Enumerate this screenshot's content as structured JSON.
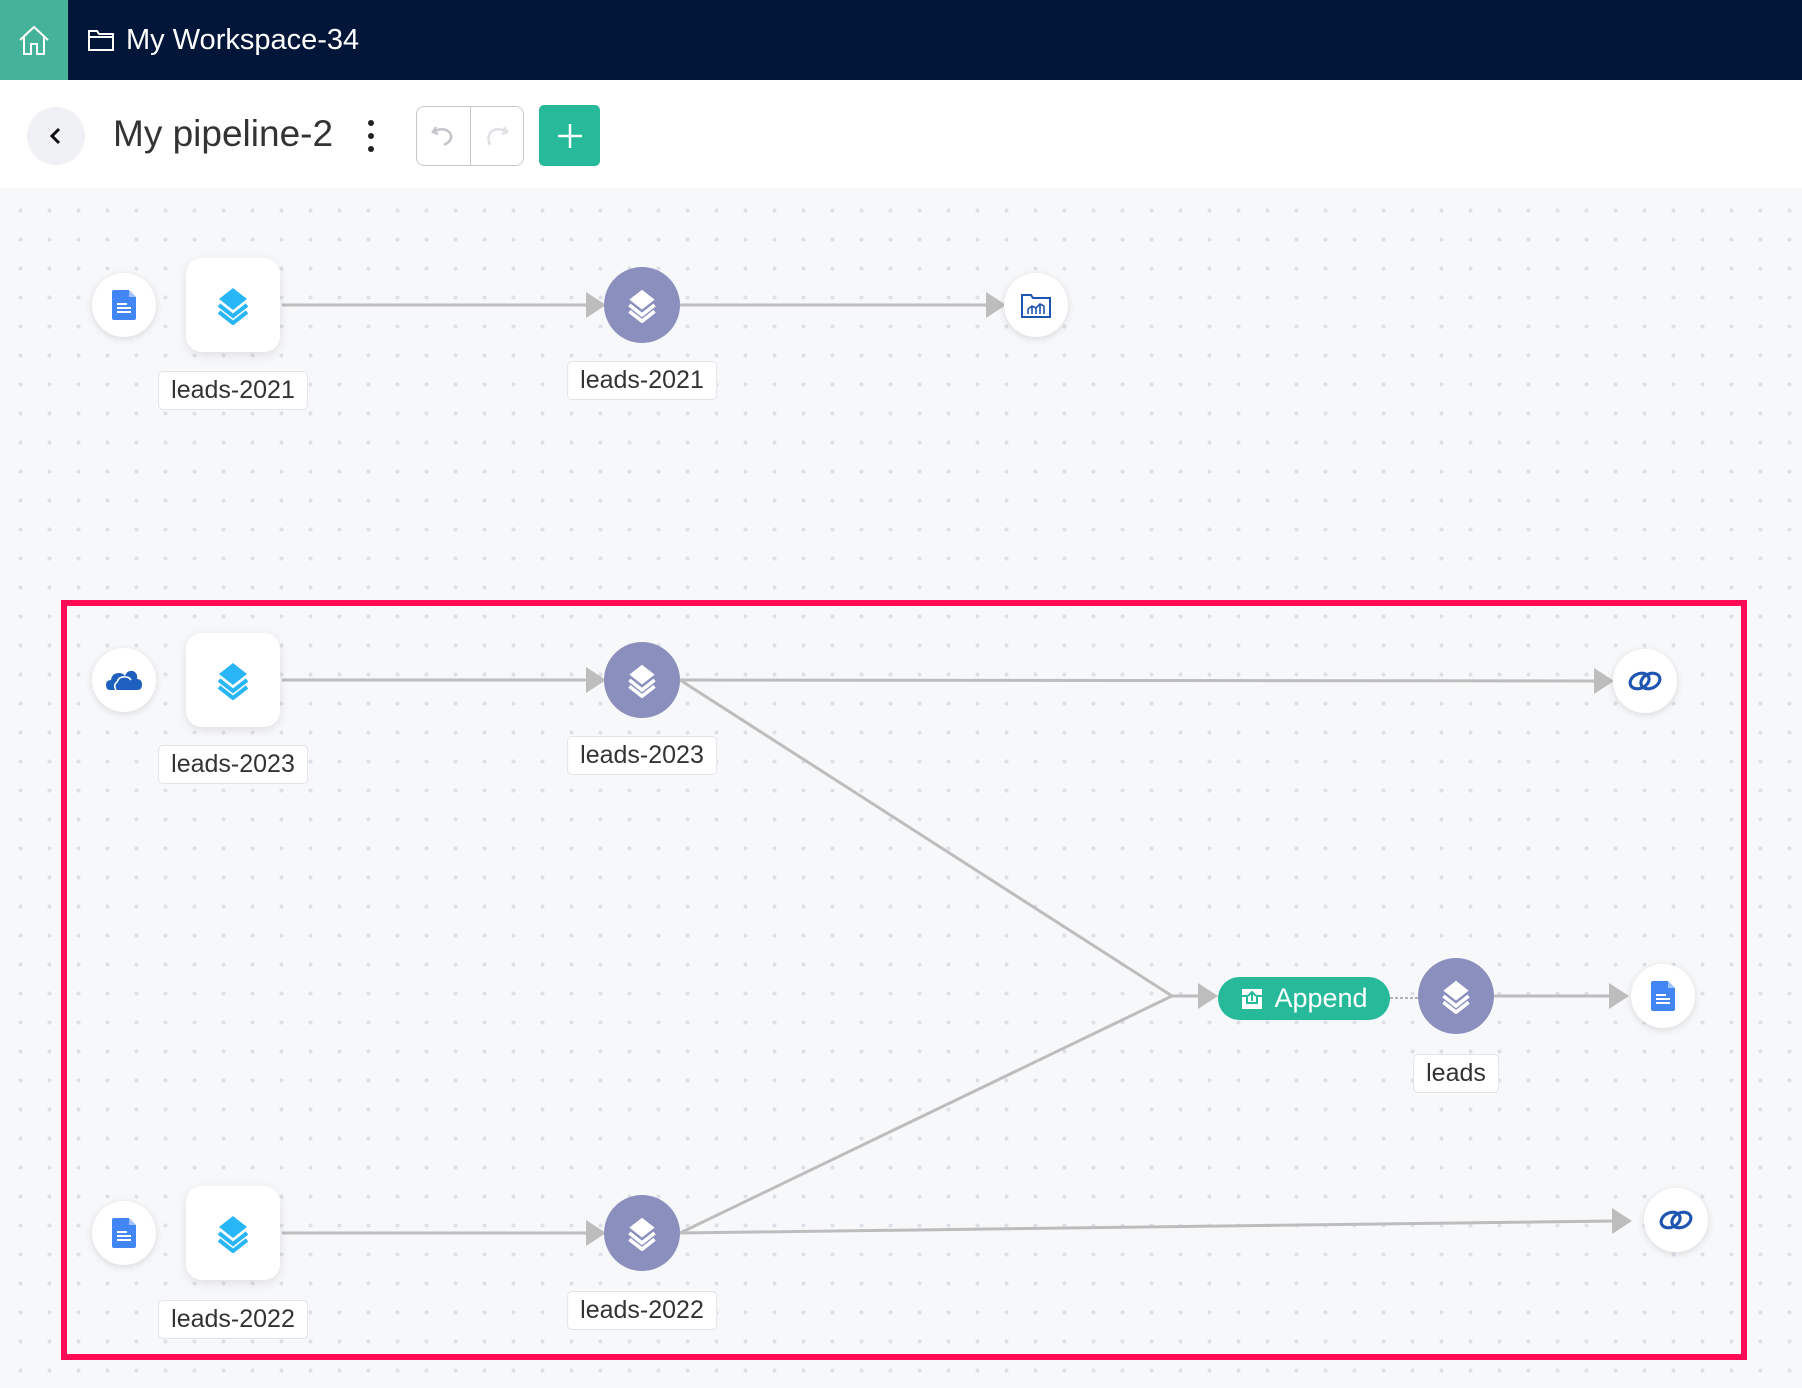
{
  "header": {
    "home_icon": "home-icon",
    "workspace_icon": "folder-icon",
    "workspace": "My Workspace-34"
  },
  "toolbar": {
    "title": "My pipeline-2",
    "back_icon": "chevron-left-icon",
    "more_icon": "kebab-icon",
    "undo_icon": "undo-icon",
    "redo_icon": "redo-icon",
    "add_icon": "plus-icon"
  },
  "colors": {
    "accent": "#26b99a",
    "header": "#02163a",
    "home": "#45b39a",
    "node": "#8a8fbd",
    "highlight": "#ff0a54",
    "edge": "#bdbdbd"
  },
  "pipeline": {
    "row1": {
      "source_icon": "google-docs-icon",
      "import_label": "leads-2021",
      "dataset_label": "leads-2021",
      "dest_icon": "analytics-folder-icon"
    },
    "row2": {
      "source_icon": "onedrive-cloud-icon",
      "import_label": "leads-2023",
      "dataset_label": "leads-2023",
      "dest_icon": "zoho-link-icon"
    },
    "row3": {
      "source_icon": "google-docs-icon",
      "import_label": "leads-2022",
      "dataset_label": "leads-2022",
      "dest_icon": "zoho-link-icon"
    },
    "append": {
      "label": "Append",
      "icon": "append-icon",
      "output_label": "leads",
      "dest_icon": "google-docs-icon"
    }
  }
}
